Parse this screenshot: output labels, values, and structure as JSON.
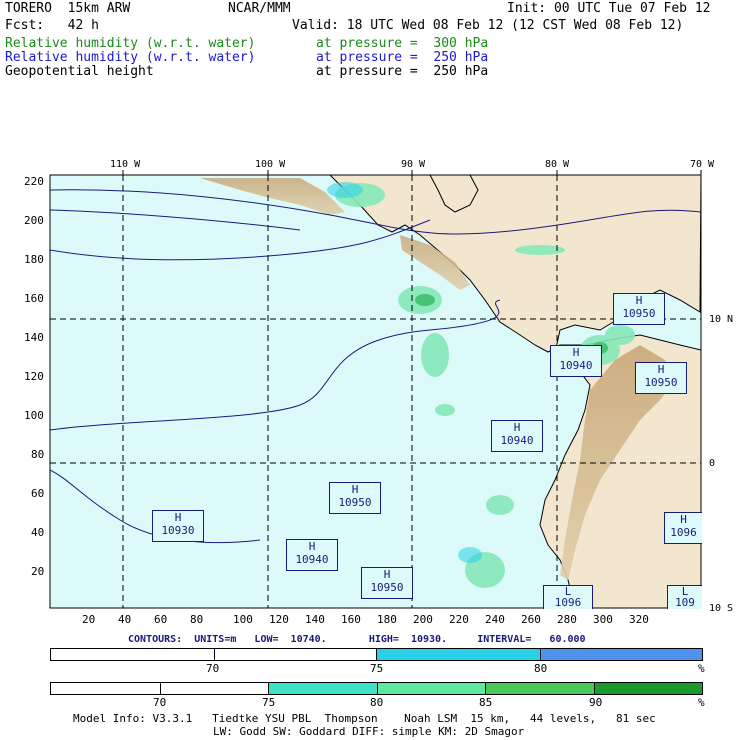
{
  "header": {
    "model": "TORERO  15km ARW",
    "org": "NCAR/MMM",
    "init": "Init: 00 UTC Tue 07 Feb 12",
    "fcst": "Fcst:   42 h",
    "valid": "Valid: 18 UTC Wed 08 Feb 12 (12 CST Wed 08 Feb 12)",
    "fields": [
      {
        "name": "Relative humidity (w.r.t. water)",
        "level": "at pressure =  300 hPa",
        "color": "#1a8a1a"
      },
      {
        "name": "Relative humidity (w.r.t. water)",
        "level": "at pressure =  250 hPa",
        "color": "#1a1ad0"
      },
      {
        "name": "Geopotential height",
        "level": "at pressure =  250 hPa",
        "color": "#000000"
      }
    ]
  },
  "map": {
    "top_lon_labels": [
      "110 W",
      "100 W",
      "90 W",
      "80 W",
      "70 W"
    ],
    "right_lat_labels": [
      "10 N",
      "0",
      "10 S"
    ],
    "y_ticks": [
      "220",
      "200",
      "180",
      "160",
      "140",
      "120",
      "100",
      "80",
      "60",
      "40",
      "20"
    ],
    "x_ticks": [
      "20",
      "40",
      "60",
      "80",
      "100",
      "120",
      "140",
      "160",
      "180",
      "200",
      "220",
      "240",
      "260",
      "280",
      "300",
      "320"
    ],
    "ocean_color": "#ddfafa",
    "highs": [
      {
        "label": "H",
        "value": "10950"
      },
      {
        "label": "H",
        "value": "10940"
      },
      {
        "label": "H",
        "value": "10950"
      },
      {
        "label": "H",
        "value": "10940"
      },
      {
        "label": "H",
        "value": "10950"
      },
      {
        "label": "H",
        "value": "10930"
      },
      {
        "label": "H",
        "value": "10940"
      },
      {
        "label": "H",
        "value": "10950"
      },
      {
        "label": "H",
        "value": "1096"
      },
      {
        "label": "L",
        "value": "1096"
      },
      {
        "label": "L",
        "value": "109"
      }
    ]
  },
  "contours": {
    "text": "CONTOURS:  UNITS=m   LOW=  10740.       HIGH=  10930.     INTERVAL=   60.000"
  },
  "colorbar1": {
    "labels": [
      "70",
      "75",
      "80"
    ],
    "unit": "%",
    "colors": [
      "#ffffff",
      "#ffffff",
      "#2ad0e8",
      "#4d94ec"
    ]
  },
  "colorbar2": {
    "labels": [
      "70",
      "75",
      "80",
      "85",
      "90"
    ],
    "unit": "%",
    "colors": [
      "#ffffff",
      "#ffffff",
      "#ffffff",
      "#3ee0c8",
      "#5ee8a0",
      "#48c858",
      "#1a9a2a"
    ]
  },
  "footer": {
    "line1": "Model Info: V3.3.1   Tiedtke YSU PBL  Thompson    Noah LSM  15 km,   44 levels,   81 sec",
    "line2": "LW: Godd SW: Goddard DIFF: simple KM: 2D Smagor"
  }
}
